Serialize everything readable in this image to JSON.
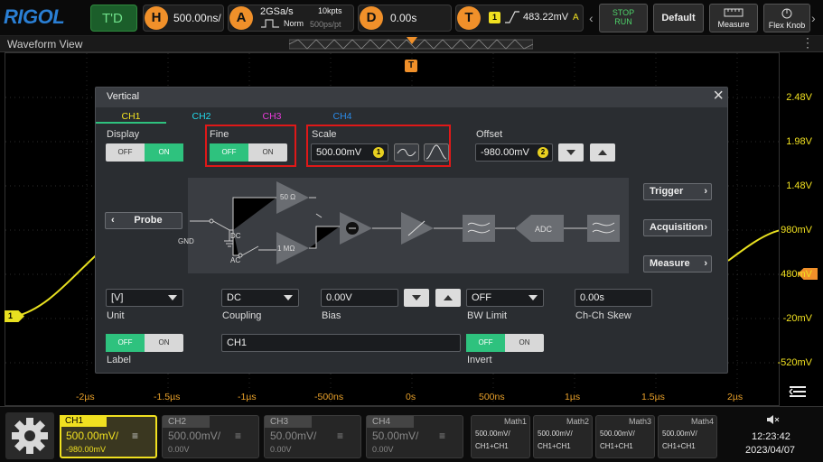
{
  "topbar": {
    "logo": "RIGOL",
    "mode": "T'D",
    "h_icon": "H",
    "h_value": "500.00ns/",
    "a_icon": "A",
    "sample_rate": "2GSa/s",
    "norm": "Norm",
    "kpts": "10kpts",
    "ps_pt": "500ps/pt",
    "d_icon": "D",
    "d_value": "0.00s",
    "t_icon": "T",
    "t_ch": "1",
    "t_value": "483.22mV",
    "t_mode": "A",
    "stop_label": "STOP",
    "run_label": "RUN",
    "default_label": "Default",
    "measure_label": "Measure",
    "flexknob_label": "Flex Knob"
  },
  "waveform": {
    "title": "Waveform View",
    "trigger_marker": "T",
    "y_labels": [
      "2.48V",
      "1.98V",
      "1.48V",
      "980mV",
      "480mV",
      "-20mV",
      "-520mV"
    ],
    "x_labels": [
      "-2µs",
      "-1.5µs",
      "-1µs",
      "-500ns",
      "0s",
      "500ns",
      "1µs",
      "1.5µs",
      "2µs"
    ],
    "ch1_marker": "1"
  },
  "dialog": {
    "title": "Vertical",
    "tabs": [
      "CH1",
      "CH2",
      "CH3",
      "CH4"
    ],
    "tab_colors": [
      "#f0e020",
      "#22d8e8",
      "#e83ad8",
      "#2a8ae8"
    ],
    "display_label": "Display",
    "display_off": "OFF",
    "display_on": "ON",
    "fine_label": "Fine",
    "fine_off": "OFF",
    "fine_on": "ON",
    "scale_label": "Scale",
    "scale_value": "500.00mV",
    "scale_badge": "1",
    "offset_label": "Offset",
    "offset_value": "-980.00mV",
    "offset_badge": "2",
    "probe_label": "Probe",
    "gnd_label": "GND",
    "dc_label": "DC",
    "ac_label": "AC",
    "r50": "50 Ω",
    "r1m": "1 MΩ",
    "adc": "ADC",
    "trigger_btn": "Trigger",
    "acquisition_btn": "Acquisition",
    "measure_btn": "Measure",
    "unit_value": "[V]",
    "unit_label": "Unit",
    "coupling_value": "DC",
    "coupling_label": "Coupling",
    "bias_value": "0.00V",
    "bias_label": "Bias",
    "bwlimit_value": "OFF",
    "bwlimit_label": "BW Limit",
    "skew_value": "0.00s",
    "skew_label": "Ch-Ch Skew",
    "label_off": "OFF",
    "label_on": "ON",
    "label_label": "Label",
    "label_value": "CH1",
    "invert_off": "OFF",
    "invert_on": "ON",
    "invert_label": "Invert"
  },
  "bottom": {
    "channels": [
      {
        "name": "CH1",
        "scale": "500.00mV/",
        "offset": "-980.00mV"
      },
      {
        "name": "CH2",
        "scale": "500.00mV/",
        "offset": "0.00V"
      },
      {
        "name": "CH3",
        "scale": "50.00mV/",
        "offset": "0.00V"
      },
      {
        "name": "CH4",
        "scale": "50.00mV/",
        "offset": "0.00V"
      }
    ],
    "maths": [
      {
        "name": "Math1",
        "scale": "500.00mV/",
        "src": "CH1+CH1"
      },
      {
        "name": "Math2",
        "scale": "500.00mV/",
        "src": "CH1+CH1"
      },
      {
        "name": "Math3",
        "scale": "500.00mV/",
        "src": "CH1+CH1"
      },
      {
        "name": "Math4",
        "scale": "500.00mV/",
        "src": "CH1+CH1"
      }
    ],
    "time": "12:23:42",
    "date": "2023/04/07"
  },
  "colors": {
    "ch1": "#f0e020",
    "accent_orange": "#f0902a",
    "toggle_green": "#2ec27e",
    "highlight_red": "#e01818"
  }
}
